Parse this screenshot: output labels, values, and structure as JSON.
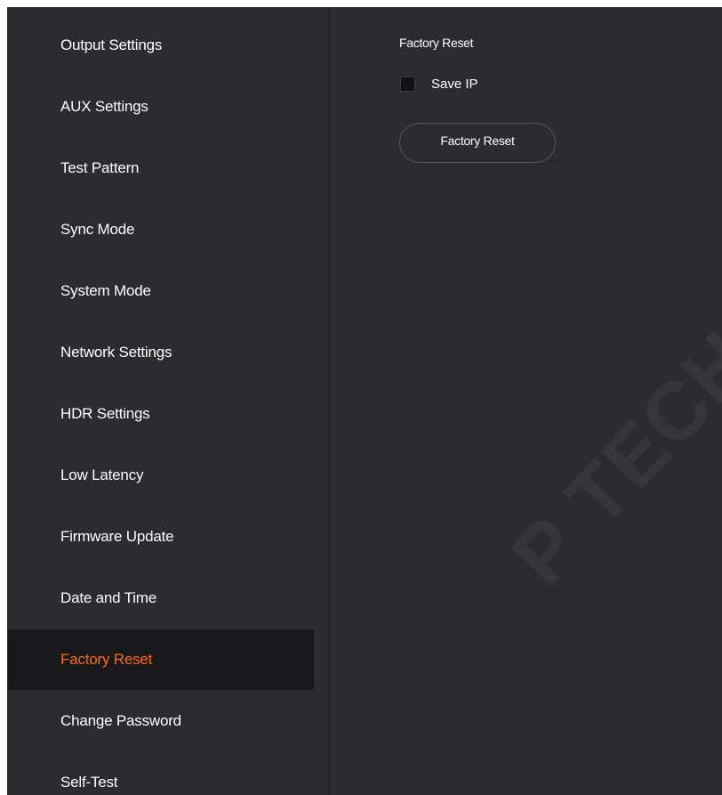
{
  "sidebar": {
    "items": [
      {
        "label": "Output Settings",
        "active": false
      },
      {
        "label": "AUX Settings",
        "active": false
      },
      {
        "label": "Test Pattern",
        "active": false
      },
      {
        "label": "Sync Mode",
        "active": false
      },
      {
        "label": "System Mode",
        "active": false
      },
      {
        "label": "Network Settings",
        "active": false
      },
      {
        "label": "HDR Settings",
        "active": false
      },
      {
        "label": "Low Latency",
        "active": false
      },
      {
        "label": "Firmware Update",
        "active": false
      },
      {
        "label": "Date and Time",
        "active": false
      },
      {
        "label": "Factory Reset",
        "active": true
      },
      {
        "label": "Change Password",
        "active": false
      },
      {
        "label": "Self-Test",
        "active": false
      }
    ]
  },
  "main": {
    "section_title": "Factory Reset",
    "save_ip": {
      "label": "Save IP",
      "checked": false
    },
    "reset_button_label": "Factory Reset"
  },
  "watermark": "P TECH C",
  "colors": {
    "background": "#2b2b30",
    "active_item_background": "#18181a",
    "active_item_text": "#ff6a00",
    "text": "#ffffff"
  }
}
